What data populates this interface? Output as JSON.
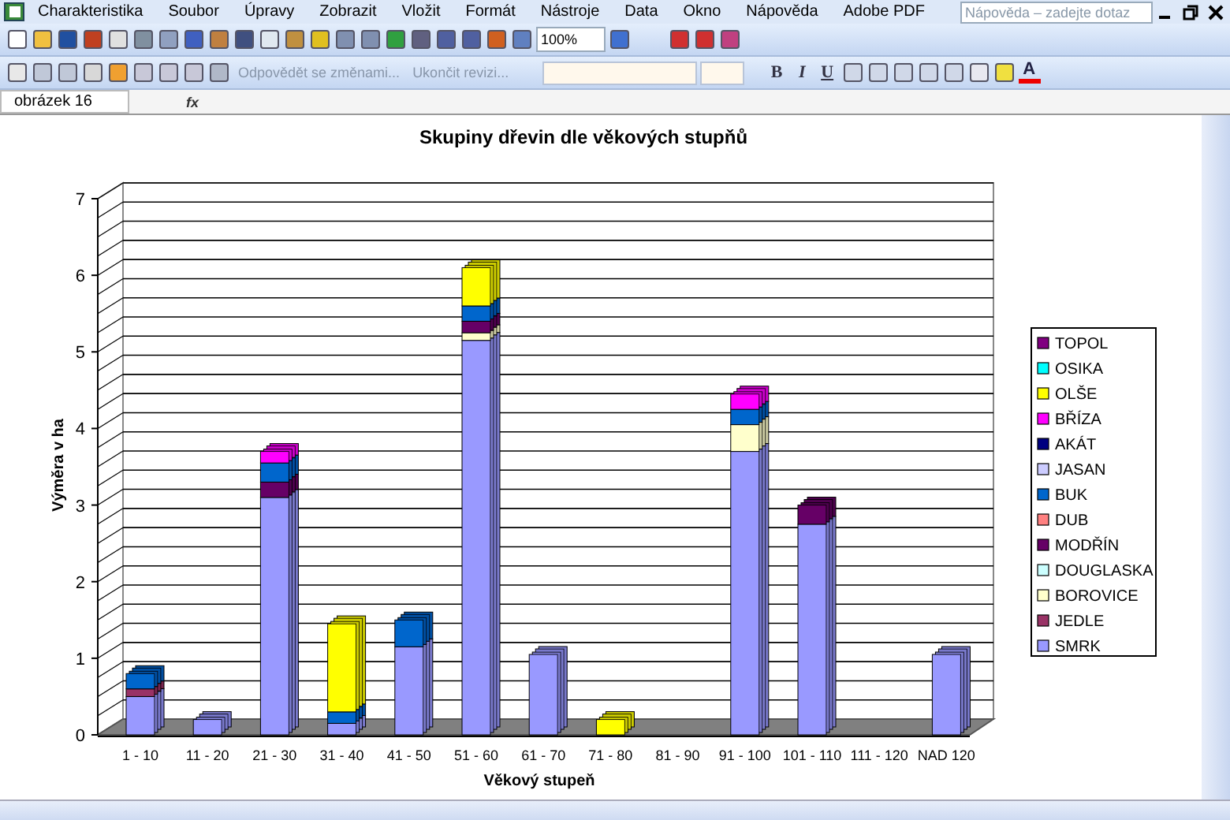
{
  "menu": [
    "Charakteristika",
    "Soubor",
    "Úpravy",
    "Zobrazit",
    "Vložit",
    "Formát",
    "Nástroje",
    "Data",
    "Okno",
    "Nápověda",
    "Adobe PDF"
  ],
  "help_search": {
    "placeholder": "Nápověda – zadejte dotaz"
  },
  "standard_toolbar": {
    "zoom": "100%"
  },
  "review_toolbar": {
    "buttons": [
      "Odpovědět se změnami...",
      "Ukončit revizi..."
    ]
  },
  "formatting_toolbar": {
    "buttons": [
      "B",
      "I",
      "U"
    ],
    "font_color_label": "A"
  },
  "formula_bar": {
    "name_box": "obrázek 16",
    "function_label": "fx"
  },
  "chart": {
    "chart_data": {
      "type": "bar",
      "title": "Skupiny dřevin dle věkových stupňů",
      "xlabel": "Věkový stupeň",
      "ylabel": "Výměra v ha",
      "stacked": true,
      "legend": "right",
      "ylim": [
        0,
        7
      ],
      "yticks": [
        0,
        1,
        2,
        3,
        4,
        5,
        6,
        7
      ],
      "categories": [
        "1 - 10",
        "11 - 20",
        "21 - 30",
        "31 - 40",
        "41 - 50",
        "51 - 60",
        "61 - 70",
        "71 - 80",
        "81 - 90",
        "91 - 100",
        "101 - 110",
        "111 - 120",
        "NAD 120"
      ],
      "series": [
        {
          "name": "SMRK",
          "color": "#9999ff",
          "values": [
            0.5,
            0.2,
            3.1,
            0.15,
            1.15,
            5.15,
            1.05,
            0,
            0,
            3.7,
            2.75,
            0,
            1.05
          ]
        },
        {
          "name": "JEDLE",
          "color": "#993366",
          "values": [
            0.1,
            0,
            0,
            0,
            0,
            0,
            0,
            0,
            0,
            0,
            0,
            0,
            0
          ]
        },
        {
          "name": "BOROVICE",
          "color": "#ffffcc",
          "values": [
            0,
            0,
            0,
            0,
            0,
            0.1,
            0,
            0,
            0,
            0.35,
            0,
            0,
            0
          ]
        },
        {
          "name": "DOUGLASKA",
          "color": "#ccffff",
          "values": [
            0,
            0,
            0,
            0,
            0,
            0,
            0,
            0,
            0,
            0,
            0,
            0,
            0
          ]
        },
        {
          "name": "MODŘÍN",
          "color": "#660066",
          "values": [
            0,
            0,
            0.2,
            0,
            0,
            0.15,
            0,
            0,
            0,
            0,
            0.25,
            0,
            0
          ]
        },
        {
          "name": "DUB",
          "color": "#ff8080",
          "values": [
            0,
            0,
            0,
            0,
            0,
            0,
            0,
            0,
            0,
            0,
            0,
            0,
            0
          ]
        },
        {
          "name": "BUK",
          "color": "#0066cc",
          "values": [
            0.2,
            0,
            0.25,
            0.15,
            0.35,
            0.2,
            0,
            0,
            0,
            0.2,
            0,
            0,
            0
          ]
        },
        {
          "name": "JASAN",
          "color": "#ccccff",
          "values": [
            0,
            0,
            0,
            0,
            0,
            0,
            0,
            0,
            0,
            0,
            0,
            0,
            0
          ]
        },
        {
          "name": "AKÁT",
          "color": "#000080",
          "values": [
            0,
            0,
            0,
            0,
            0,
            0,
            0,
            0,
            0,
            0,
            0,
            0,
            0
          ]
        },
        {
          "name": "BŘÍZA",
          "color": "#ff00ff",
          "values": [
            0,
            0,
            0.15,
            0,
            0,
            0,
            0,
            0,
            0,
            0.2,
            0,
            0,
            0
          ]
        },
        {
          "name": "OLŠE",
          "color": "#ffff00",
          "values": [
            0,
            0,
            0,
            1.15,
            0,
            0.5,
            0,
            0.2,
            0,
            0,
            0,
            0,
            0
          ]
        },
        {
          "name": "OSIKA",
          "color": "#00ffff",
          "values": [
            0,
            0,
            0,
            0,
            0,
            0,
            0,
            0,
            0,
            0,
            0,
            0,
            0
          ]
        },
        {
          "name": "TOPOL",
          "color": "#800080",
          "values": [
            0,
            0,
            0,
            0,
            0,
            0,
            0,
            0,
            0,
            0,
            0,
            0,
            0
          ]
        }
      ]
    }
  }
}
